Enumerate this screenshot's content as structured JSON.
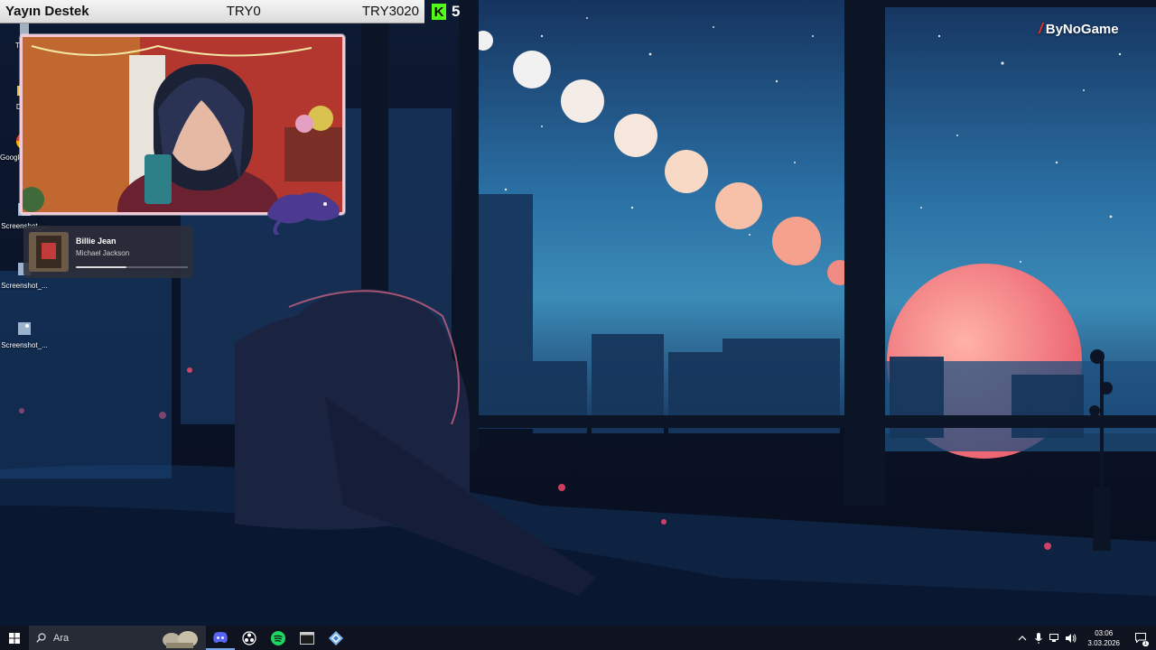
{
  "donation_bar": {
    "title": "Yayın Destek",
    "current": "TRY0",
    "goal": "TRY3020"
  },
  "kick": {
    "logo_letter": "K",
    "count": "5",
    "color": "#53fc18"
  },
  "brand": {
    "name": "ByNoGame"
  },
  "desktop_icons": [
    {
      "label": "Trash",
      "icon": "recycle-bin-icon"
    },
    {
      "label": "Desk",
      "icon": "folder-icon"
    },
    {
      "label": "Google Chrome",
      "icon": "chrome-icon"
    },
    {
      "label": "Screenshot_...",
      "icon": "image-file-icon"
    },
    {
      "label": "Screenshot_...",
      "icon": "image-file-icon"
    },
    {
      "label": "Screenshot_...",
      "icon": "image-file-icon"
    }
  ],
  "now_playing": {
    "title": "Billie Jean",
    "artist": "Michael Jackson",
    "progress": 0.45
  },
  "taskbar": {
    "search_placeholder": "Ara",
    "apps": [
      {
        "name": "discord",
        "icon": "discord-icon",
        "active": true
      },
      {
        "name": "obs",
        "icon": "obs-icon",
        "active": false
      },
      {
        "name": "spotify",
        "icon": "spotify-icon",
        "active": false
      },
      {
        "name": "terminal",
        "icon": "terminal-icon",
        "active": false
      },
      {
        "name": "app",
        "icon": "app-icon",
        "active": false
      }
    ],
    "time": "03:06",
    "date": "3.03.2026",
    "notification_count": "1"
  },
  "colors": {
    "sky": "#1f5a8f",
    "moon": "#f28a8a",
    "accent": "#7aa7e8"
  }
}
